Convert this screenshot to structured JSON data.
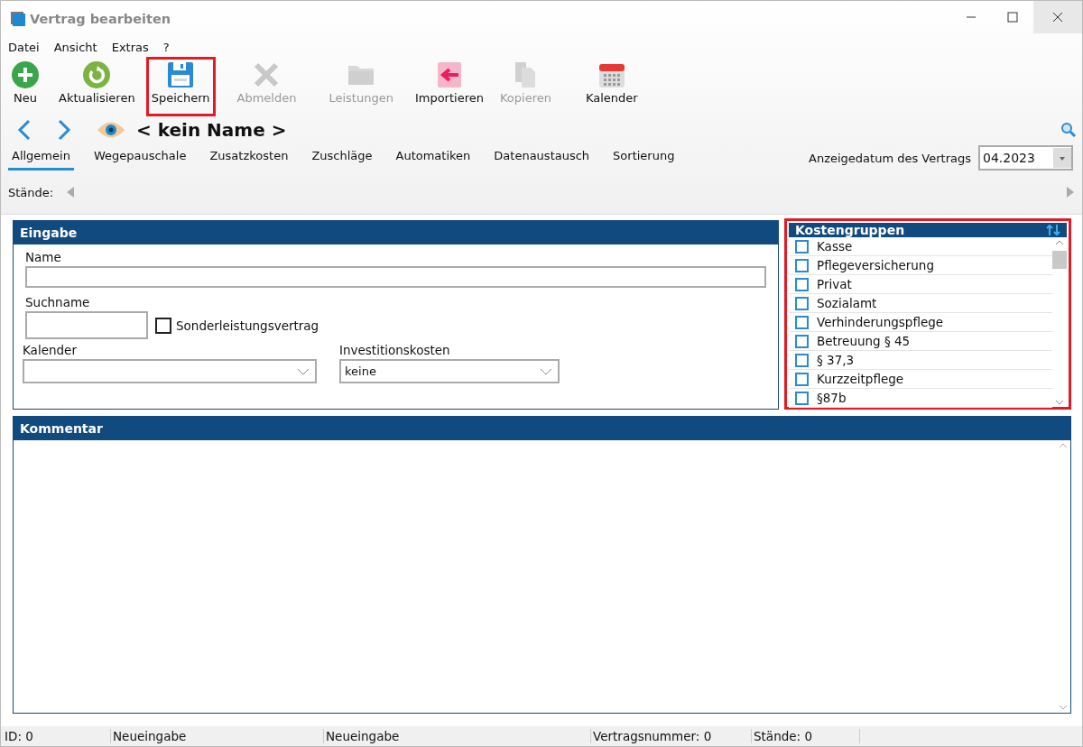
{
  "window": {
    "title": "Vertrag bearbeiten"
  },
  "menu": [
    "Datei",
    "Ansicht",
    "Extras",
    "?"
  ],
  "toolbar": [
    {
      "kind": "add",
      "label": "Neu",
      "disabled": false,
      "highlighted": false
    },
    {
      "kind": "refresh",
      "label": "Aktualisieren",
      "disabled": false,
      "highlighted": false
    },
    {
      "kind": "save",
      "label": "Speichern",
      "disabled": false,
      "highlighted": true
    },
    {
      "kind": "cancel",
      "label": "Abmelden",
      "disabled": true,
      "highlighted": false
    },
    {
      "kind": "folder",
      "label": "Leistungen",
      "disabled": true,
      "highlighted": false
    },
    {
      "kind": "import",
      "label": "Importieren",
      "disabled": false,
      "highlighted": false
    },
    {
      "kind": "copy",
      "label": "Kopieren",
      "disabled": true,
      "highlighted": false
    },
    {
      "kind": "calendar",
      "label": "Kalender",
      "disabled": false,
      "highlighted": false
    }
  ],
  "record_title": "< kein Name >",
  "tabs": [
    {
      "label": "Allgemein",
      "selected": true
    },
    {
      "label": "Wegepauschale",
      "selected": false
    },
    {
      "label": "Zusatzkosten",
      "selected": false
    },
    {
      "label": "Zuschläge",
      "selected": false
    },
    {
      "label": "Automatiken",
      "selected": false
    },
    {
      "label": "Datenaustausch",
      "selected": false
    },
    {
      "label": "Sortierung",
      "selected": false
    }
  ],
  "display_date": {
    "label": "Anzeigedatum des Vertrags",
    "value": "04.2023"
  },
  "staende": {
    "label": "Stände:"
  },
  "eingabe": {
    "title": "Eingabe",
    "name_label": "Name",
    "suchname_label": "Suchname",
    "special_checkbox": {
      "label": "Sonderleistungsvertrag",
      "checked": false
    },
    "kalender_label": "Kalender",
    "investition_label": "Investitionskosten",
    "investition_value": "keine"
  },
  "kostengruppen": {
    "title": "Kostengruppen",
    "highlighted": true,
    "items": [
      {
        "label": "Kasse",
        "checked": false
      },
      {
        "label": "Pflegeversicherung",
        "checked": false
      },
      {
        "label": "Privat",
        "checked": false
      },
      {
        "label": "Sozialamt",
        "checked": false
      },
      {
        "label": "Verhinderungspflege",
        "checked": false
      },
      {
        "label": "Betreuung § 45",
        "checked": false
      },
      {
        "label": "§ 37,3",
        "checked": false
      },
      {
        "label": "Kurzzeitpflege",
        "checked": false
      },
      {
        "label": "§87b",
        "checked": false
      }
    ]
  },
  "kommentar": {
    "title": "Kommentar"
  },
  "status_bar": [
    "ID: 0",
    "Neueingabe",
    "Neueingabe",
    "Vertragsnummer: 0",
    "Stände: 0"
  ]
}
